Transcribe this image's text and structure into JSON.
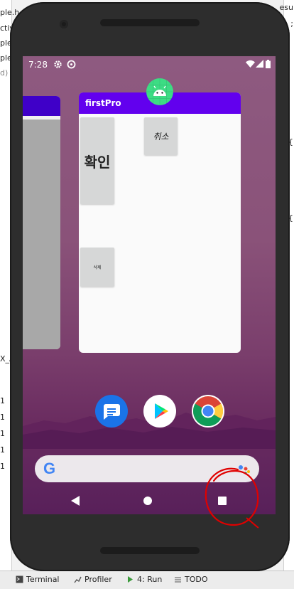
{
  "ide": {
    "left_fragments": [
      "ple.h",
      "ctiv",
      "ple",
      "ple",
      "d)",
      "X_A",
      "1",
      "1",
      "1",
      "1",
      "1"
    ],
    "right_fragments": [
      "esu",
      ";",
      "{",
      "{"
    ],
    "bottom_tabs": [
      {
        "icon": "terminal-icon",
        "label": "Terminal"
      },
      {
        "icon": "profiler-icon",
        "label": "Profiler"
      },
      {
        "icon": "run-icon",
        "label": "4: Run"
      },
      {
        "icon": "todo-icon",
        "label": "TODO"
      }
    ]
  },
  "status_bar": {
    "time": "7:28",
    "left_icons": [
      "settings-icon",
      "sync-icon"
    ],
    "right_icons": [
      "wifi-icon",
      "signal-icon",
      "battery-icon"
    ]
  },
  "recents": {
    "app_title": "firstPro",
    "app_icon": "android-icon",
    "buttons": {
      "confirm": "확인",
      "cancel": "취소",
      "delete": "삭제"
    },
    "colors": {
      "titlebar": "#6200ee",
      "left_card_bar": "#3f00c8"
    }
  },
  "dock": {
    "apps": [
      "messages-icon",
      "play-store-icon",
      "chrome-icon"
    ]
  },
  "search_bar": {
    "logo": "G",
    "mic": "assistant-icon"
  },
  "nav_bar": {
    "buttons": [
      "back-icon",
      "home-icon",
      "recents-icon"
    ]
  },
  "annotation": {
    "color": "#e00000",
    "target": "recents-button"
  }
}
